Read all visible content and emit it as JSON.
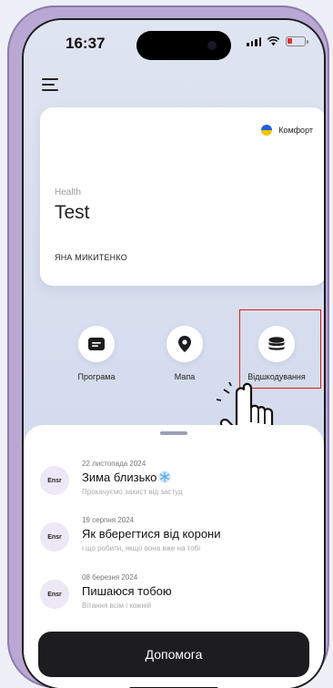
{
  "status_bar": {
    "time": "16:37"
  },
  "card": {
    "badge_label": "Комфорт",
    "category": "Health",
    "title": "Test",
    "owner": "ЯНА МИКИТЕНКО"
  },
  "actions": [
    {
      "label": "Програма",
      "icon": "card-icon"
    },
    {
      "label": "Мапа",
      "icon": "map-pin-icon"
    },
    {
      "label": "Відшкодування",
      "icon": "coins-stack-icon"
    }
  ],
  "news": [
    {
      "avatar": "Ensr",
      "date": "22 листопада 2024",
      "title": "Зима близько",
      "subtitle": "Прокачуємо захист від застуд",
      "emoji": "snowflake-icon"
    },
    {
      "avatar": "Ensr",
      "date": "19 серпня 2024",
      "title": "Як вберегтися від корони",
      "subtitle": "і що робити, якщо вона вже на тобі"
    },
    {
      "avatar": "Ensr",
      "date": "08 березня 2024",
      "title": "Пишаюся тобою",
      "subtitle": "Вітання всім і кожній"
    }
  ],
  "help_button": "Допомога",
  "colors": {
    "highlight": "#e0191a",
    "button_dark": "#1d1d1f",
    "screen_bg": "#dfe4f1"
  }
}
